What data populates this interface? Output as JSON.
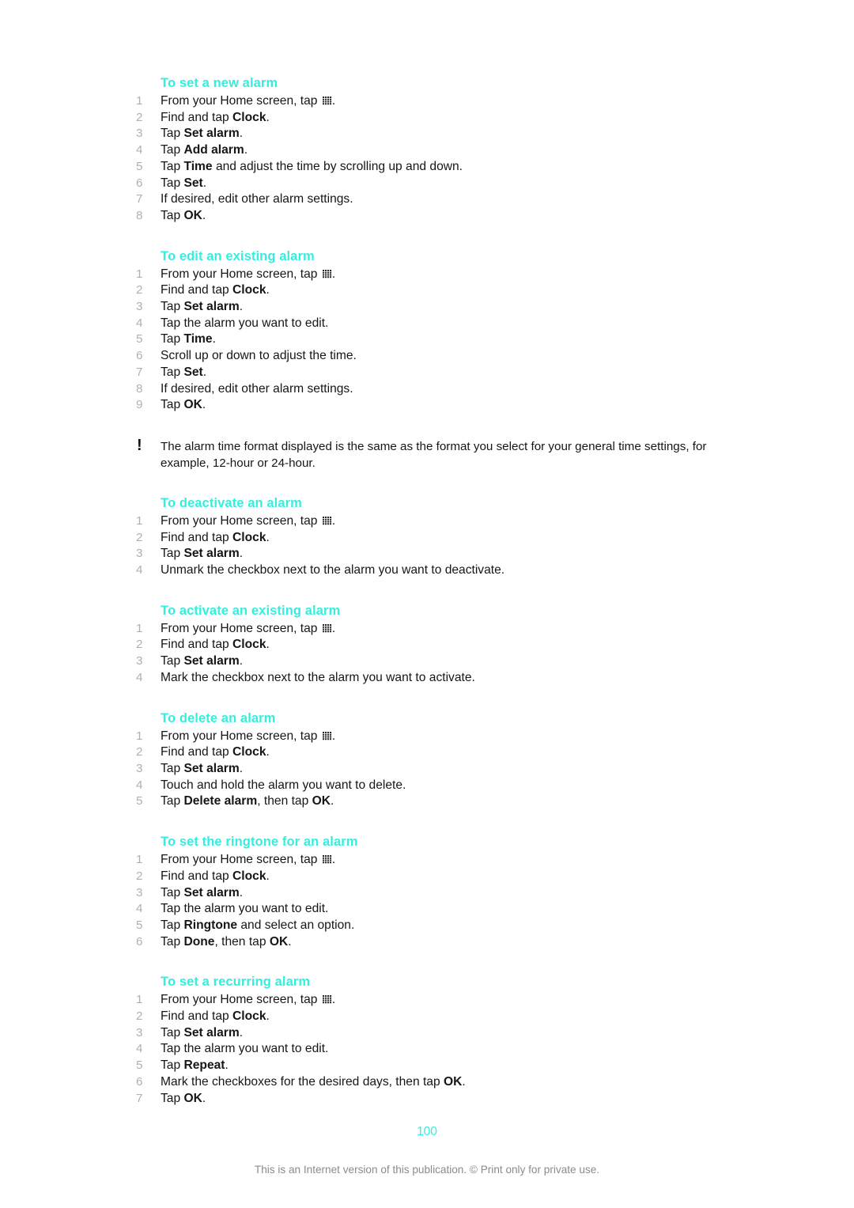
{
  "document": {
    "page_number": "100",
    "footer_note": "This is an Internet version of this publication. © Print only for private use.",
    "accent_color": "#33efdd",
    "number_color": "#b0b0b0",
    "footer_color": "#8b8b8b"
  },
  "icons": {
    "app_drawer": "grid-icon",
    "note": "exclamation-icon",
    "note_glyph": "!"
  },
  "sections": [
    {
      "heading": "To set a new alarm",
      "steps": [
        {
          "num": "1",
          "parts": [
            {
              "t": "text",
              "v": "From your Home screen, tap "
            },
            {
              "t": "icon",
              "v": "grid-icon"
            },
            {
              "t": "text",
              "v": "."
            }
          ]
        },
        {
          "num": "2",
          "parts": [
            {
              "t": "text",
              "v": "Find and tap "
            },
            {
              "t": "bold",
              "v": "Clock"
            },
            {
              "t": "text",
              "v": "."
            }
          ]
        },
        {
          "num": "3",
          "parts": [
            {
              "t": "text",
              "v": "Tap "
            },
            {
              "t": "bold",
              "v": "Set alarm"
            },
            {
              "t": "text",
              "v": "."
            }
          ]
        },
        {
          "num": "4",
          "parts": [
            {
              "t": "text",
              "v": "Tap "
            },
            {
              "t": "bold",
              "v": "Add alarm"
            },
            {
              "t": "text",
              "v": "."
            }
          ]
        },
        {
          "num": "5",
          "parts": [
            {
              "t": "text",
              "v": "Tap "
            },
            {
              "t": "bold",
              "v": "Time"
            },
            {
              "t": "text",
              "v": " and adjust the time by scrolling up and down."
            }
          ]
        },
        {
          "num": "6",
          "parts": [
            {
              "t": "text",
              "v": "Tap "
            },
            {
              "t": "bold",
              "v": "Set"
            },
            {
              "t": "text",
              "v": "."
            }
          ]
        },
        {
          "num": "7",
          "parts": [
            {
              "t": "text",
              "v": "If desired, edit other alarm settings."
            }
          ]
        },
        {
          "num": "8",
          "parts": [
            {
              "t": "text",
              "v": "Tap "
            },
            {
              "t": "bold",
              "v": "OK"
            },
            {
              "t": "text",
              "v": "."
            }
          ]
        }
      ]
    },
    {
      "heading": "To edit an existing alarm",
      "steps": [
        {
          "num": "1",
          "parts": [
            {
              "t": "text",
              "v": "From your Home screen, tap "
            },
            {
              "t": "icon",
              "v": "grid-icon"
            },
            {
              "t": "text",
              "v": "."
            }
          ]
        },
        {
          "num": "2",
          "parts": [
            {
              "t": "text",
              "v": "Find and tap "
            },
            {
              "t": "bold",
              "v": "Clock"
            },
            {
              "t": "text",
              "v": "."
            }
          ]
        },
        {
          "num": "3",
          "parts": [
            {
              "t": "text",
              "v": "Tap "
            },
            {
              "t": "bold",
              "v": "Set alarm"
            },
            {
              "t": "text",
              "v": "."
            }
          ]
        },
        {
          "num": "4",
          "parts": [
            {
              "t": "text",
              "v": "Tap the alarm you want to edit."
            }
          ]
        },
        {
          "num": "5",
          "parts": [
            {
              "t": "text",
              "v": "Tap "
            },
            {
              "t": "bold",
              "v": "Time"
            },
            {
              "t": "text",
              "v": "."
            }
          ]
        },
        {
          "num": "6",
          "parts": [
            {
              "t": "text",
              "v": "Scroll up or down to adjust the time."
            }
          ]
        },
        {
          "num": "7",
          "parts": [
            {
              "t": "text",
              "v": "Tap "
            },
            {
              "t": "bold",
              "v": "Set"
            },
            {
              "t": "text",
              "v": "."
            }
          ]
        },
        {
          "num": "8",
          "parts": [
            {
              "t": "text",
              "v": "If desired, edit other alarm settings."
            }
          ]
        },
        {
          "num": "9",
          "parts": [
            {
              "t": "text",
              "v": "Tap "
            },
            {
              "t": "bold",
              "v": "OK"
            },
            {
              "t": "text",
              "v": "."
            }
          ]
        }
      ],
      "note": "The alarm time format displayed is the same as the format you select for your general time settings, for example, 12-hour or 24-hour."
    },
    {
      "heading": "To deactivate an alarm",
      "steps": [
        {
          "num": "1",
          "parts": [
            {
              "t": "text",
              "v": "From your Home screen, tap "
            },
            {
              "t": "icon",
              "v": "grid-icon"
            },
            {
              "t": "text",
              "v": "."
            }
          ]
        },
        {
          "num": "2",
          "parts": [
            {
              "t": "text",
              "v": "Find and tap "
            },
            {
              "t": "bold",
              "v": "Clock"
            },
            {
              "t": "text",
              "v": "."
            }
          ]
        },
        {
          "num": "3",
          "parts": [
            {
              "t": "text",
              "v": "Tap "
            },
            {
              "t": "bold",
              "v": "Set alarm"
            },
            {
              "t": "text",
              "v": "."
            }
          ]
        },
        {
          "num": "4",
          "parts": [
            {
              "t": "text",
              "v": "Unmark the checkbox next to the alarm you want to deactivate."
            }
          ]
        }
      ]
    },
    {
      "heading": "To activate an existing alarm",
      "steps": [
        {
          "num": "1",
          "parts": [
            {
              "t": "text",
              "v": "From your Home screen, tap "
            },
            {
              "t": "icon",
              "v": "grid-icon"
            },
            {
              "t": "text",
              "v": "."
            }
          ]
        },
        {
          "num": "2",
          "parts": [
            {
              "t": "text",
              "v": "Find and tap "
            },
            {
              "t": "bold",
              "v": "Clock"
            },
            {
              "t": "text",
              "v": "."
            }
          ]
        },
        {
          "num": "3",
          "parts": [
            {
              "t": "text",
              "v": "Tap "
            },
            {
              "t": "bold",
              "v": "Set alarm"
            },
            {
              "t": "text",
              "v": "."
            }
          ]
        },
        {
          "num": "4",
          "parts": [
            {
              "t": "text",
              "v": "Mark the checkbox next to the alarm you want to activate."
            }
          ]
        }
      ]
    },
    {
      "heading": "To delete an alarm",
      "steps": [
        {
          "num": "1",
          "parts": [
            {
              "t": "text",
              "v": "From your Home screen, tap "
            },
            {
              "t": "icon",
              "v": "grid-icon"
            },
            {
              "t": "text",
              "v": "."
            }
          ]
        },
        {
          "num": "2",
          "parts": [
            {
              "t": "text",
              "v": "Find and tap "
            },
            {
              "t": "bold",
              "v": "Clock"
            },
            {
              "t": "text",
              "v": "."
            }
          ]
        },
        {
          "num": "3",
          "parts": [
            {
              "t": "text",
              "v": "Tap "
            },
            {
              "t": "bold",
              "v": "Set alarm"
            },
            {
              "t": "text",
              "v": "."
            }
          ]
        },
        {
          "num": "4",
          "parts": [
            {
              "t": "text",
              "v": "Touch and hold the alarm you want to delete."
            }
          ]
        },
        {
          "num": "5",
          "parts": [
            {
              "t": "text",
              "v": "Tap "
            },
            {
              "t": "bold",
              "v": "Delete alarm"
            },
            {
              "t": "text",
              "v": ", then tap "
            },
            {
              "t": "bold",
              "v": "OK"
            },
            {
              "t": "text",
              "v": "."
            }
          ]
        }
      ]
    },
    {
      "heading": "To set the ringtone for an alarm",
      "steps": [
        {
          "num": "1",
          "parts": [
            {
              "t": "text",
              "v": "From your Home screen, tap "
            },
            {
              "t": "icon",
              "v": "grid-icon"
            },
            {
              "t": "text",
              "v": "."
            }
          ]
        },
        {
          "num": "2",
          "parts": [
            {
              "t": "text",
              "v": "Find and tap "
            },
            {
              "t": "bold",
              "v": "Clock"
            },
            {
              "t": "text",
              "v": "."
            }
          ]
        },
        {
          "num": "3",
          "parts": [
            {
              "t": "text",
              "v": "Tap "
            },
            {
              "t": "bold",
              "v": "Set alarm"
            },
            {
              "t": "text",
              "v": "."
            }
          ]
        },
        {
          "num": "4",
          "parts": [
            {
              "t": "text",
              "v": "Tap the alarm you want to edit."
            }
          ]
        },
        {
          "num": "5",
          "parts": [
            {
              "t": "text",
              "v": "Tap "
            },
            {
              "t": "bold",
              "v": "Ringtone"
            },
            {
              "t": "text",
              "v": " and select an option."
            }
          ]
        },
        {
          "num": "6",
          "parts": [
            {
              "t": "text",
              "v": "Tap "
            },
            {
              "t": "bold",
              "v": "Done"
            },
            {
              "t": "text",
              "v": ", then tap "
            },
            {
              "t": "bold",
              "v": "OK"
            },
            {
              "t": "text",
              "v": "."
            }
          ]
        }
      ]
    },
    {
      "heading": "To set a recurring alarm",
      "steps": [
        {
          "num": "1",
          "parts": [
            {
              "t": "text",
              "v": "From your Home screen, tap "
            },
            {
              "t": "icon",
              "v": "grid-icon"
            },
            {
              "t": "text",
              "v": "."
            }
          ]
        },
        {
          "num": "2",
          "parts": [
            {
              "t": "text",
              "v": "Find and tap "
            },
            {
              "t": "bold",
              "v": "Clock"
            },
            {
              "t": "text",
              "v": "."
            }
          ]
        },
        {
          "num": "3",
          "parts": [
            {
              "t": "text",
              "v": "Tap "
            },
            {
              "t": "bold",
              "v": "Set alarm"
            },
            {
              "t": "text",
              "v": "."
            }
          ]
        },
        {
          "num": "4",
          "parts": [
            {
              "t": "text",
              "v": "Tap the alarm you want to edit."
            }
          ]
        },
        {
          "num": "5",
          "parts": [
            {
              "t": "text",
              "v": "Tap "
            },
            {
              "t": "bold",
              "v": "Repeat"
            },
            {
              "t": "text",
              "v": "."
            }
          ]
        },
        {
          "num": "6",
          "parts": [
            {
              "t": "text",
              "v": "Mark the checkboxes for the desired days, then tap "
            },
            {
              "t": "bold",
              "v": "OK"
            },
            {
              "t": "text",
              "v": "."
            }
          ]
        },
        {
          "num": "7",
          "parts": [
            {
              "t": "text",
              "v": "Tap "
            },
            {
              "t": "bold",
              "v": "OK"
            },
            {
              "t": "text",
              "v": "."
            }
          ]
        }
      ]
    }
  ]
}
